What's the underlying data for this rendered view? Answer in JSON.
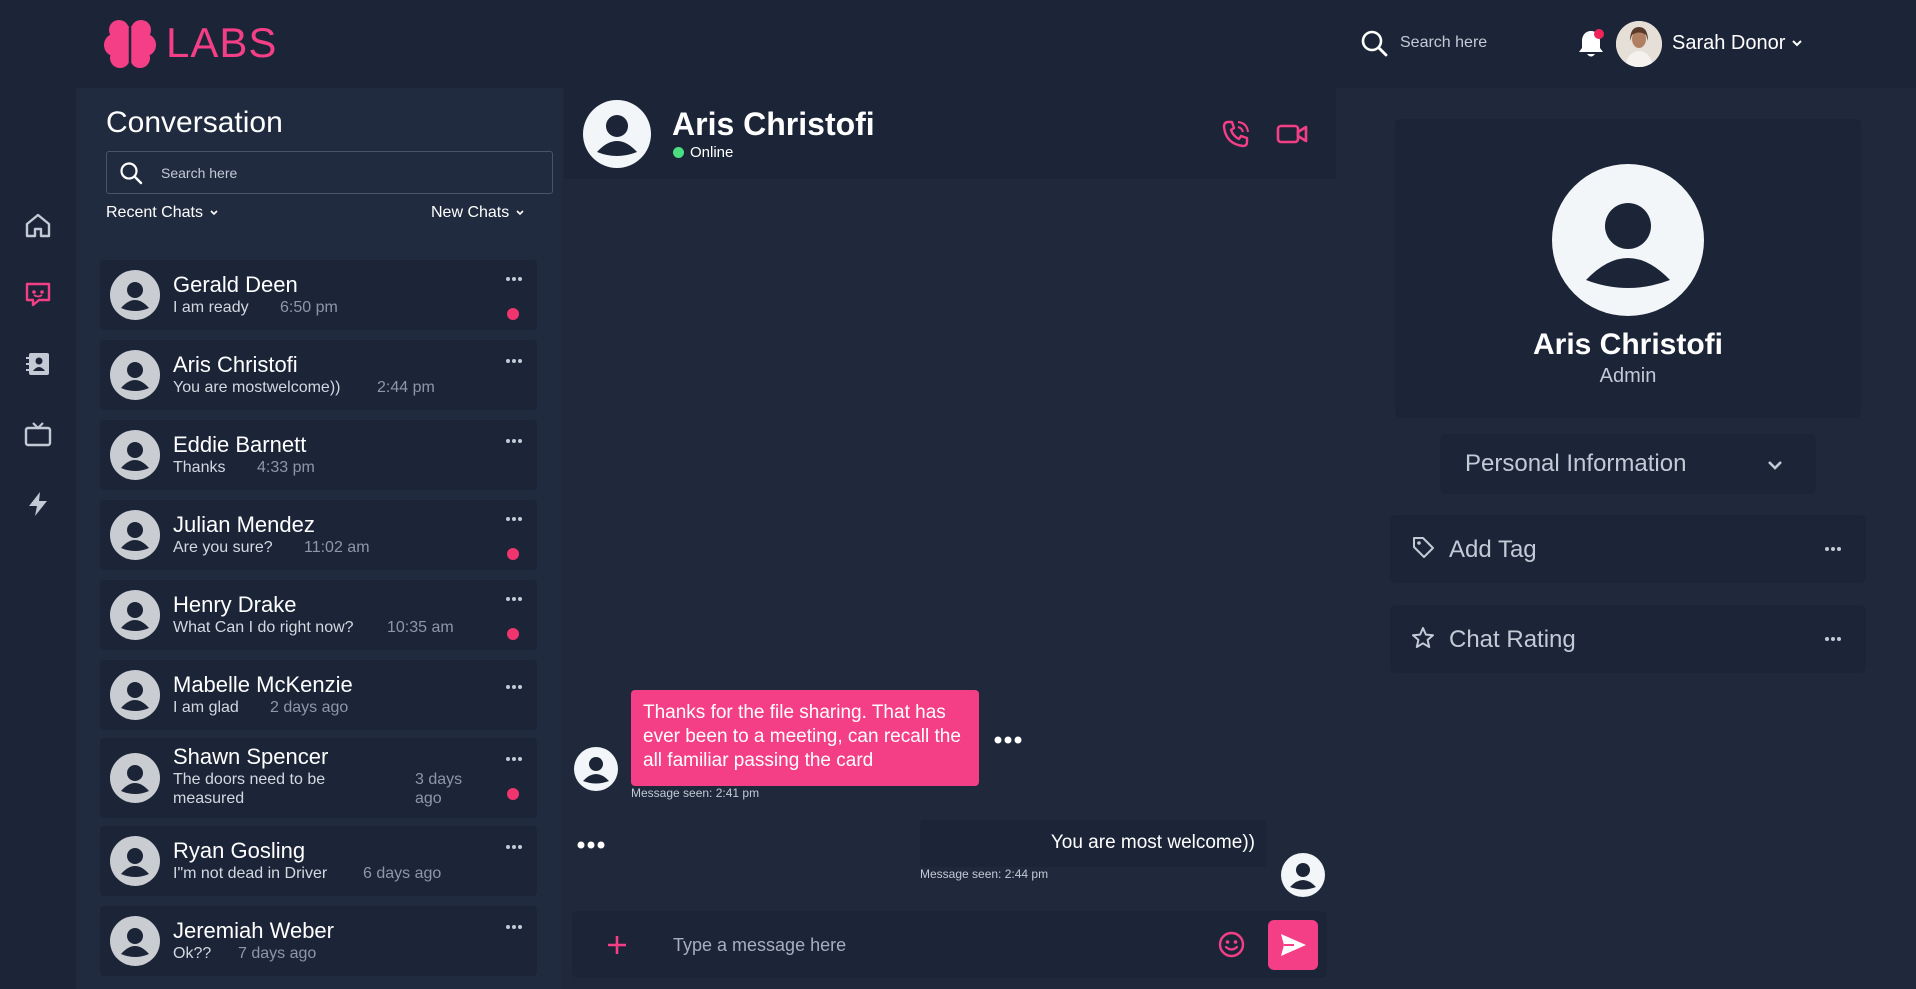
{
  "app": {
    "logo_text": "LABS",
    "brand_color": "#f43f86"
  },
  "topbar": {
    "search_placeholder": "Search here",
    "user_name": "Sarah Donor",
    "has_notification": true
  },
  "rail": {
    "icons": [
      "home-icon",
      "chat-icon",
      "contacts-icon",
      "tv-icon",
      "bolt-icon"
    ],
    "active": "chat-icon"
  },
  "conversation": {
    "title": "Conversation",
    "search_placeholder": "Search here",
    "filter_recent": "Recent Chats",
    "filter_new": "New Chats",
    "chats": [
      {
        "name": "Gerald Deen",
        "message": "I am ready",
        "time": "6:50 pm",
        "unread": true
      },
      {
        "name": "Aris Christofi",
        "message": "You are mostwelcome))",
        "time": "2:44 pm",
        "unread": false
      },
      {
        "name": "Eddie Barnett",
        "message": "Thanks",
        "time": "4:33 pm",
        "unread": false
      },
      {
        "name": "Julian Mendez",
        "message": "Are you sure?",
        "time": "11:02 am",
        "unread": true
      },
      {
        "name": "Henry Drake",
        "message": "What Can I do right now?",
        "time": "10:35 am",
        "unread": true
      },
      {
        "name": "Mabelle McKenzie",
        "message": "I am glad",
        "time": "2 days ago",
        "unread": false
      },
      {
        "name": "Shawn Spencer",
        "message_line1": "The doors need to be",
        "message_line2": "measured",
        "time_line1": "3 days",
        "time_line2": "ago",
        "unread": true
      },
      {
        "name": "Ryan Gosling",
        "message": "I\"m not dead in Driver",
        "time": "6 days ago",
        "unread": false
      },
      {
        "name": "Jeremiah Weber",
        "message": "Ok??",
        "time": "7 days ago",
        "unread": false
      }
    ]
  },
  "chat": {
    "contact_name": "Aris Christofi",
    "status": "Online",
    "messages": [
      {
        "direction": "incoming",
        "text": "Thanks for the file sharing. That has ever been to a meeting, can recall the all familiar passing the card",
        "seen": "Message seen: 2:41 pm"
      },
      {
        "direction": "outgoing",
        "text": "You are most welcome))",
        "seen": "Message seen: 2:44 pm"
      }
    ],
    "composer_placeholder": "Type a message here"
  },
  "profile": {
    "name": "Aris Christofi",
    "role": "Admin",
    "section_label": "Personal Information",
    "add_tag_label": "Add Tag",
    "chat_rating_label": "Chat Rating"
  }
}
